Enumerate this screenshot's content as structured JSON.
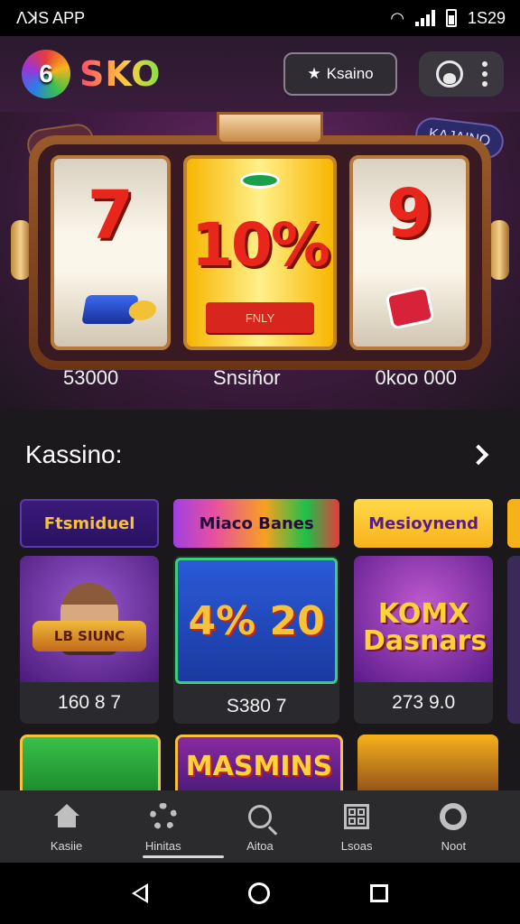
{
  "statusbar": {
    "left": "ꓥꓘS APP",
    "time": "1S29"
  },
  "header": {
    "logo_glyph": "6",
    "logo_text": "SKO",
    "pill_label": "Ksaino",
    "star": "★"
  },
  "hero": {
    "badge_left": "KUS",
    "badge_right": "KAJAINO",
    "reel_left": "7",
    "reel_center": "10%",
    "ribbon": "FNLY",
    "reel_right": "9",
    "values": [
      "53000",
      "Snsiñor",
      "0koo 000"
    ]
  },
  "section": {
    "title": "Kassino:"
  },
  "categories": [
    "Ftsmiduel",
    "Miaco Banes",
    "Mesioynend"
  ],
  "games": [
    {
      "banner": "LB SIUNC",
      "value": "160 8 7"
    },
    {
      "banner": "4% 20",
      "value": "S380 7"
    },
    {
      "banner": "KOMX Dasnars",
      "value": "273 9.0"
    }
  ],
  "games_row2": {
    "title": "MASMINS"
  },
  "bottomnav": {
    "items": [
      {
        "label": "Kasiie",
        "icon": "home-icon"
      },
      {
        "label": "Hinitas",
        "icon": "gear-icon"
      },
      {
        "label": "Aitoa",
        "icon": "search-icon"
      },
      {
        "label": "Lsoas",
        "icon": "grid-icon"
      },
      {
        "label": "Noot",
        "icon": "settings-icon"
      }
    ],
    "active_index": 1
  },
  "colors": {
    "accent": "#f7c23a",
    "background": "#1b181c",
    "nav": "#2b2a2d"
  }
}
